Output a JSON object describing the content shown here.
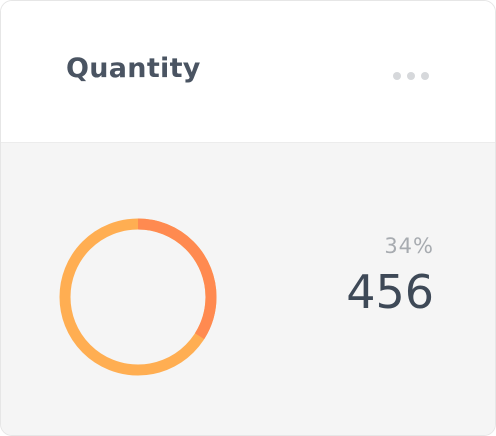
{
  "widget": {
    "title": "Quantity",
    "menu_icon": "more-horizontal-icon",
    "percent_label": "34%",
    "value": "456"
  },
  "donut": {
    "fraction": 0.34,
    "colors": {
      "filled": "#ff8a50",
      "remainder": "#ffae52"
    }
  }
}
